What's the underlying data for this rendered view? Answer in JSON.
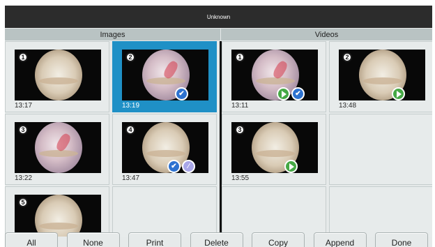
{
  "window": {
    "title": "Unknown"
  },
  "sections": {
    "images_label": "Images",
    "videos_label": "Videos"
  },
  "images": [
    {
      "number": "1",
      "time": "13:17",
      "selected": false,
      "tint": "a",
      "overlays": []
    },
    {
      "number": "2",
      "time": "13:19",
      "selected": true,
      "tint": "b",
      "overlays": [
        "check"
      ]
    },
    {
      "number": "3",
      "time": "13:22",
      "selected": false,
      "tint": "b",
      "overlays": []
    },
    {
      "number": "4",
      "time": "13:47",
      "selected": false,
      "tint": "a",
      "overlays": [
        "check",
        "pen"
      ]
    },
    {
      "number": "5",
      "time": "",
      "selected": false,
      "tint": "a",
      "overlays": []
    }
  ],
  "videos": [
    {
      "number": "1",
      "time": "13:11",
      "selected": false,
      "tint": "b",
      "overlays": [
        "play",
        "check"
      ]
    },
    {
      "number": "2",
      "time": "13:48",
      "selected": false,
      "tint": "a",
      "overlays": [
        "play"
      ]
    },
    {
      "number": "3",
      "time": "13:55",
      "selected": false,
      "tint": "a",
      "overlays": [
        "play"
      ]
    }
  ],
  "toolbar": {
    "buttons": [
      "All",
      "None",
      "Print",
      "Delete",
      "Copy",
      "Append",
      "Done"
    ]
  },
  "colors": {
    "title_bar": "#2c2c2c",
    "selected": "#1f90c6",
    "play": "#45a845",
    "check": "#2d72d0"
  }
}
